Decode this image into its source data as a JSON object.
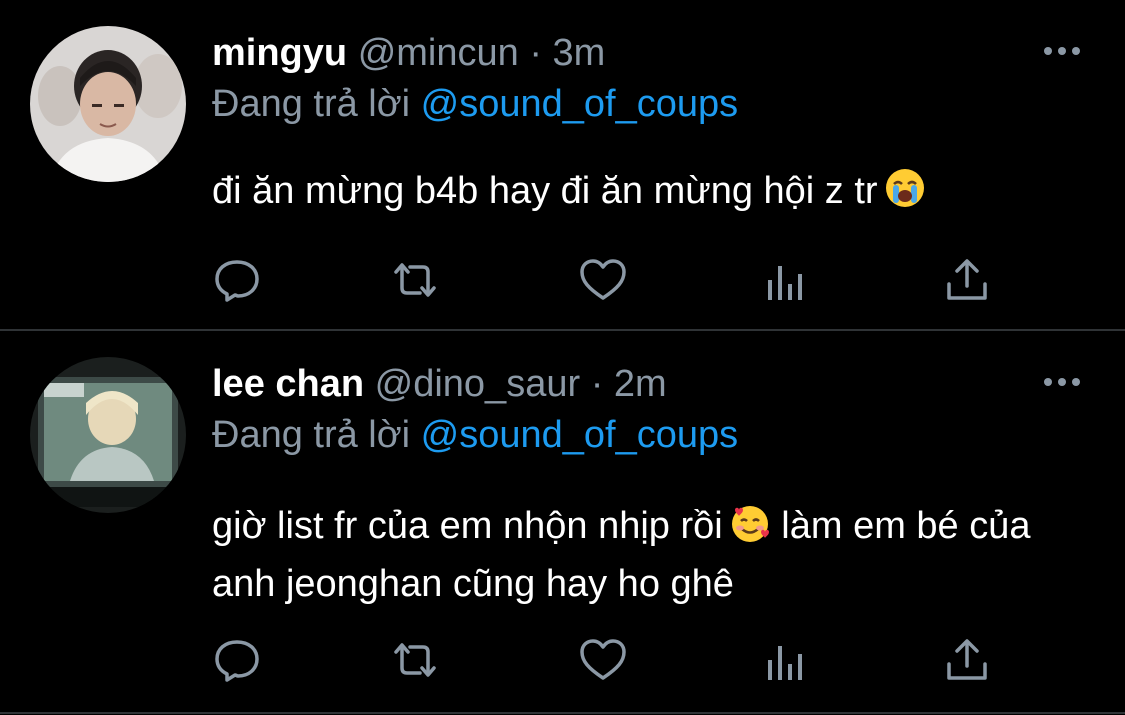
{
  "tweets": [
    {
      "display_name": "mingyu",
      "handle": "@mincun",
      "separator": "·",
      "time": "3m",
      "reply_prefix": "Đang trả lời",
      "reply_to": "@sound_of_coups",
      "text": "đi ăn mừng b4b hay đi ăn mừng hội z tr",
      "emoji": "loudly-crying-face"
    },
    {
      "display_name": "lee chan",
      "handle": "@dino_saur",
      "separator": "·",
      "time": "2m",
      "reply_prefix": "Đang trả lời",
      "reply_to": "@sound_of_coups",
      "text_part1": "giờ list fr của em nhộn nhịp rồi",
      "emoji": "smiling-face-with-hearts",
      "text_part2": " làm em bé của anh jeonghan cũng hay ho ghê"
    }
  ],
  "icons": [
    "reply-icon",
    "retweet-icon",
    "like-icon",
    "analytics-icon",
    "share-icon",
    "more-icon"
  ],
  "colors": {
    "background": "#000000",
    "primary_text": "#ffffff",
    "secondary_text": "#8b98a5",
    "mention": "#1d9bf0",
    "divider": "#2f3336"
  }
}
